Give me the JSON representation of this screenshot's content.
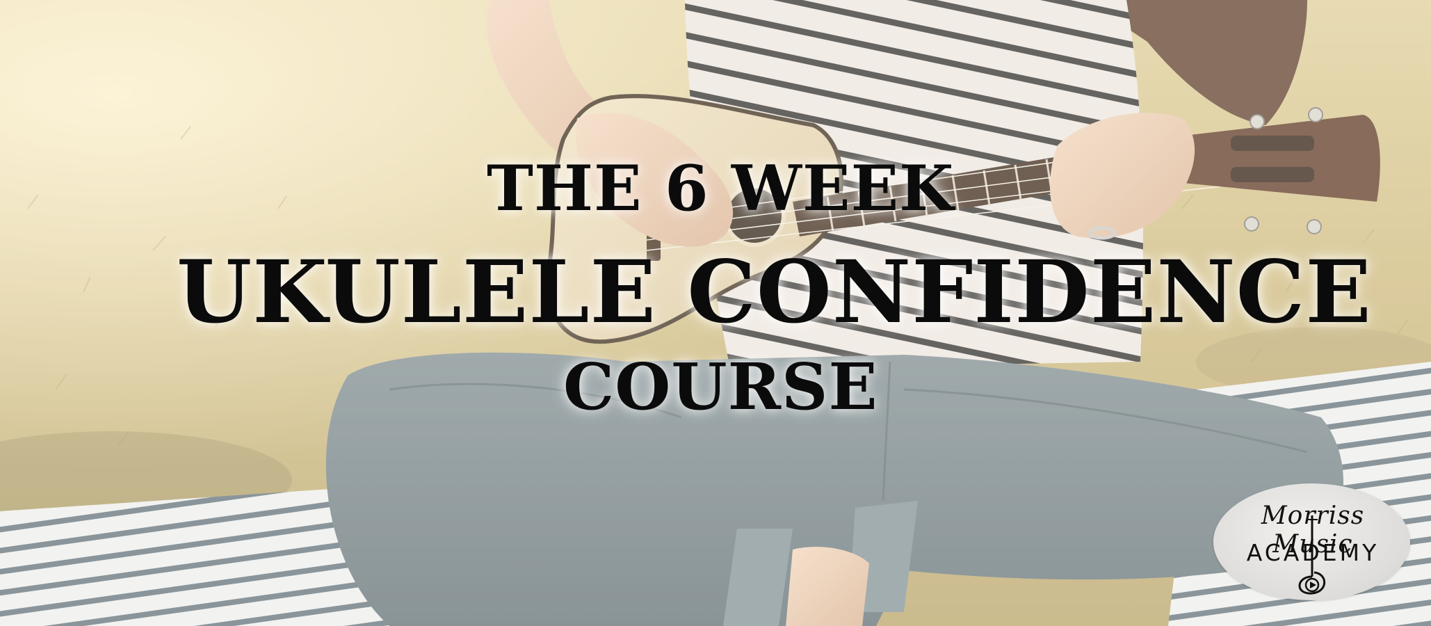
{
  "headline": {
    "line1": "THE 6 WEEK",
    "line2": "UKULELE CONFIDENCE",
    "line3": "COURSE"
  },
  "logo": {
    "top_text": "Morriss Music",
    "bottom_text": "ACADEMY"
  },
  "colors": {
    "headline_text": "#0b0b0b",
    "logo_oval": "#e3e2df",
    "grass": "#c9b67e",
    "jeans": "#6e7e88",
    "blanket_stripe": "#5e6e7c"
  },
  "icons": [
    "ukulele-image",
    "treble-clef-logo-icon"
  ]
}
